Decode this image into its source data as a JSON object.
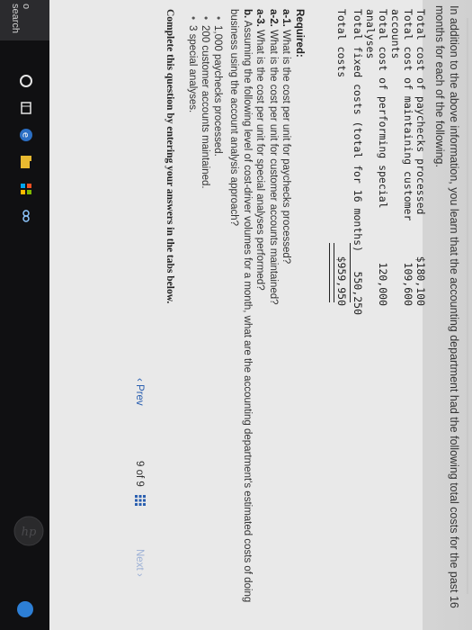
{
  "intro_text": "In addition to the above information, you learn that the accounting department had the following total costs for the past 16 months for each of the following.",
  "costs": [
    {
      "label": "Total cost of paychecks processed",
      "value": "$180,100"
    },
    {
      "label": "Total cost of maintaining customer",
      "value": "109,600"
    },
    {
      "label": "accounts",
      "value": ""
    },
    {
      "label": "Total cost of performing special",
      "value": "120,000"
    },
    {
      "label": "analyses",
      "value": ""
    },
    {
      "label": "Total fixed costs (total for 16 months)",
      "value": "550,250"
    },
    {
      "label": "Total costs",
      "value": "$959,950"
    }
  ],
  "required": {
    "heading": "Required:",
    "a1_tag": "a-1.",
    "a1": "What is the cost per unit for paychecks processed?",
    "a2_tag": "a-2.",
    "a2": "What is the cost per unit for customer accounts maintained?",
    "a3_tag": "a-3.",
    "a3": "What is the cost per unit for special analyses performed?",
    "b_tag": "b.",
    "b": "Assuming the following level of cost-driver volumes for a month, what are the accounting department's estimated costs of doing business using the account analysis approach?",
    "bullets": [
      "1,000 paychecks processed.",
      "200 customer accounts maintained.",
      "3 special analyses."
    ]
  },
  "complete_text": "Complete this question by entering your answers in the tabs below.",
  "nav": {
    "prev": "Prev",
    "page": "9 of 9",
    "next": "Next"
  },
  "taskbar": {
    "search": "o search"
  },
  "colors": {
    "link": "#2a5fb0",
    "taskbar": "#101012",
    "tray": "#2d7fd6"
  }
}
